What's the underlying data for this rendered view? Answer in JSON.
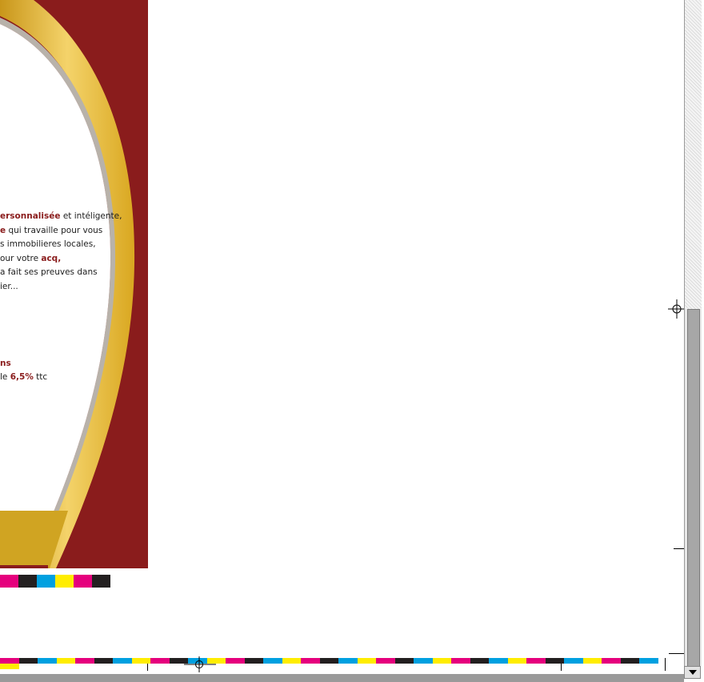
{
  "document": {
    "lines": [
      [
        {
          "t": "ersonnalisée",
          "hl": true
        },
        {
          "t": " et intéligente,",
          "hl": false
        }
      ],
      [
        {
          "t": "e",
          "hl": true
        },
        {
          "t": " qui travaille pour vous",
          "hl": false
        }
      ],
      [
        {
          "t": "s immobilieres locales,",
          "hl": false
        }
      ],
      [
        {
          "t": "our votre ",
          "hl": false
        },
        {
          "t": "acq,",
          "hl": true
        }
      ],
      [
        {
          "t": "a fait ses preuves dans",
          "hl": false
        }
      ],
      [
        {
          "t": "ier...",
          "hl": false
        }
      ]
    ],
    "lines2": [
      [
        {
          "t": "ns",
          "hl": true
        }
      ],
      [
        {
          "t": "le ",
          "hl": false
        },
        {
          "t": "6,5%",
          "hl": true
        },
        {
          "t": " ttc",
          "hl": false
        }
      ]
    ]
  },
  "colors": {
    "maroon": "#8a1c1c",
    "gold": "#e3b424",
    "cyan": "#00a0e0",
    "magenta": "#e5007d",
    "yellow": "#ffed00",
    "black": "#231f20"
  },
  "icons": {
    "registration_marks": "registration-mark-icon",
    "scroll_down": "arrow-down-icon"
  }
}
